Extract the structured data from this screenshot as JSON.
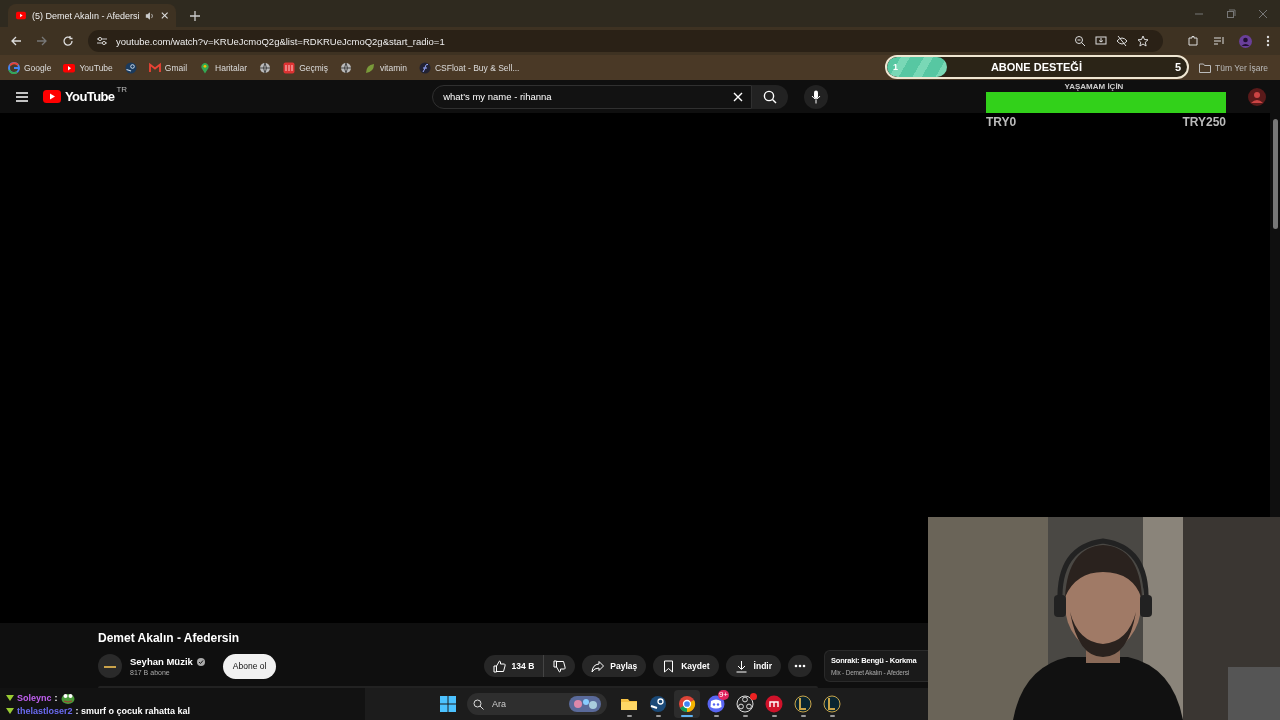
{
  "browser": {
    "tab": {
      "title": "(5) Demet Akalın - Afedersi",
      "audio_playing": true
    },
    "address": "youtube.com/watch?v=KRUeJcmoQ2g&list=RDKRUeJcmoQ2g&start_radio=1",
    "bookmarks": [
      {
        "kind": "google",
        "label": "Google"
      },
      {
        "kind": "youtube",
        "label": "YouTube"
      },
      {
        "kind": "steam"
      },
      {
        "kind": "mail",
        "label": "Gmail"
      },
      {
        "kind": "pin",
        "label": "Haritalar"
      },
      {
        "kind": "globe"
      },
      {
        "kind": "history",
        "label": "Geçmiş"
      },
      {
        "kind": "globe"
      },
      {
        "kind": "leaf",
        "label": "vitamin"
      },
      {
        "kind": "script",
        "label": "CSFloat - Buy & Sell..."
      }
    ],
    "all_bookmarks": "Tüm Yer İşare"
  },
  "youtube": {
    "logo_text": "YouTube",
    "region": "TR",
    "search": "what's my name - rihanna",
    "video": {
      "title": "Demet Akalın - Afedersin",
      "channel": "Seyhan Müzik",
      "verified": true,
      "subscribers": "817 B abone",
      "subscribe": "Abone ol",
      "likes": "134 B",
      "actions": [
        {
          "kind": "share",
          "label": "Paylaş"
        },
        {
          "kind": "save",
          "label": "Kaydet"
        },
        {
          "kind": "download",
          "label": "İndir"
        }
      ]
    },
    "next": {
      "title": "Sonraki: Bengü - Korkma",
      "subtitle": "Mix - Demet Akalın - Afedersi"
    }
  },
  "subscriber_goal": {
    "current": "1",
    "title": "ABONE DESTEĞİ",
    "target": "5",
    "level": 0.2
  },
  "donation_goal": {
    "title": "YAŞAMAM İÇİN",
    "level": 1,
    "min": "TRY0",
    "max": "TRY250"
  },
  "chat": [
    {
      "user": "Soleync",
      "color": "#c060f0",
      "message": ":",
      "emote": true
    },
    {
      "user": "thelastloser2",
      "color": "#6a6af0",
      "message": ": smurf o çocuk rahatta kal",
      "emote": false
    }
  ],
  "taskbar": {
    "search": "Ara",
    "apps": [
      {
        "kind": "folder",
        "selected": false
      },
      {
        "kind": "steam",
        "selected": false
      },
      {
        "kind": "chrome",
        "selected": true
      },
      {
        "kind": "discord",
        "selected": false,
        "badge": "9+"
      },
      {
        "kind": "obs",
        "selected": false,
        "alert": true
      },
      {
        "kind": "red",
        "selected": false
      },
      {
        "kind": "league",
        "selected": false
      },
      {
        "kind": "league",
        "selected": false
      }
    ]
  }
}
